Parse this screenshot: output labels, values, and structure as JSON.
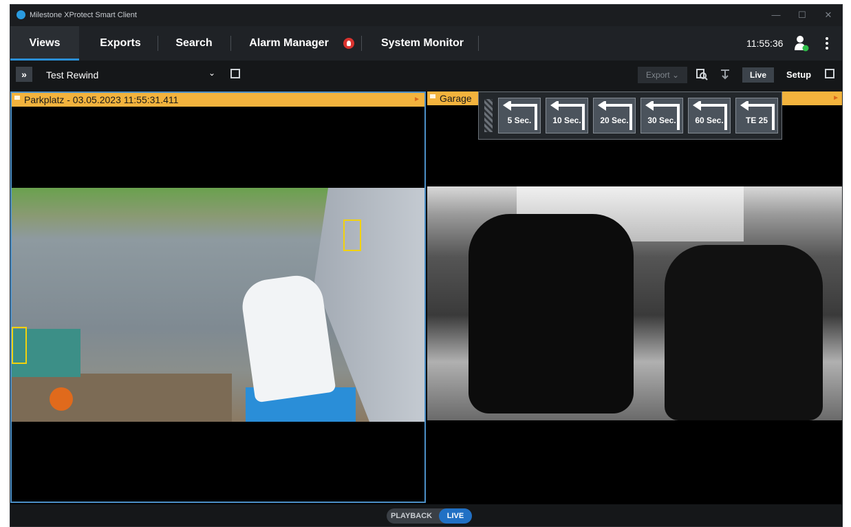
{
  "window": {
    "title": "Milestone XProtect Smart Client",
    "controls": [
      "—",
      "☐",
      "✕"
    ]
  },
  "nav": {
    "tabs": [
      {
        "label": "Views",
        "active": true
      },
      {
        "label": "Exports"
      },
      {
        "label": "Search"
      },
      {
        "label": "Alarm Manager"
      },
      {
        "label": "System Monitor"
      }
    ],
    "clock": "11:55:36",
    "icons": [
      "alarm-badge-icon",
      "user-status-icon",
      "more-menu-icon"
    ]
  },
  "toolbar": {
    "expand_glyph": "»",
    "view_name": "Test Rewind",
    "caret": "⌄",
    "export_label": "Export ⌄",
    "live_label": "Live",
    "setup_label": "Setup"
  },
  "cameras": [
    {
      "label": "Parkplatz - 03.05.2023 11:55:31.411",
      "arrow": "►"
    },
    {
      "label": "Garage",
      "arrow": "►"
    }
  ],
  "rewind": {
    "buttons": [
      "5 Sec.",
      "10 Sec.",
      "20 Sec.",
      "30 Sec.",
      "60 Sec.",
      "TE 25"
    ]
  },
  "mode": {
    "playback": "PLAYBACK",
    "live": "LIVE"
  },
  "colors": {
    "accent": "#2a8fd6",
    "camera_header": "#f3b33d",
    "live_toggle": "#2170c4",
    "alarm": "#d9332f",
    "status_online": "#2fbf4a"
  }
}
